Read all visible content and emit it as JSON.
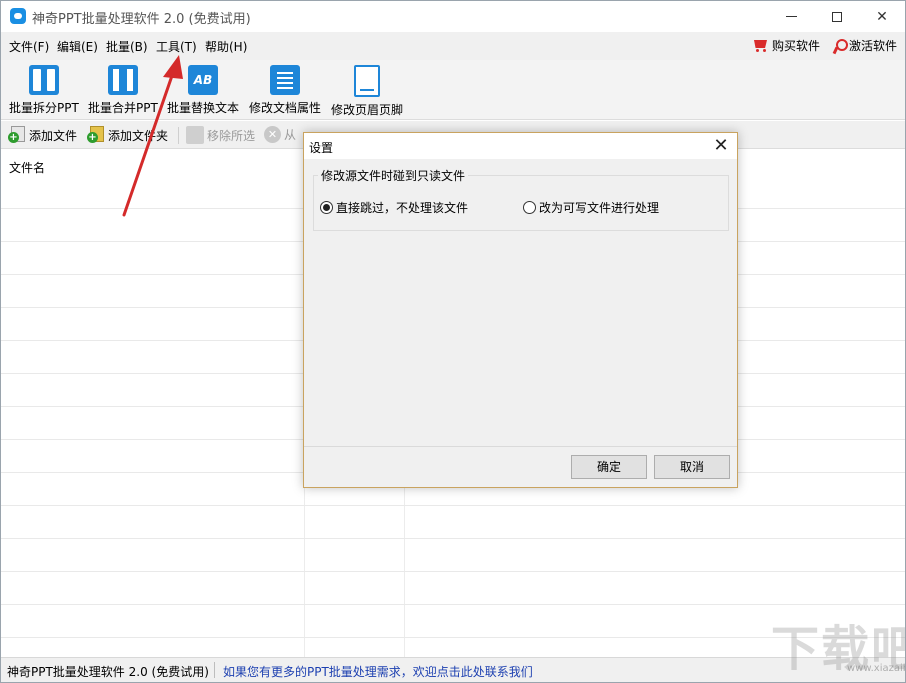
{
  "window": {
    "title": "神奇PPT批量处理软件 2.0 (免费试用)"
  },
  "menu": {
    "items": [
      {
        "name": "menu-file",
        "label": "文件(F)"
      },
      {
        "name": "menu-edit",
        "label": "编辑(E)"
      },
      {
        "name": "menu-batch",
        "label": "批量(B)"
      },
      {
        "name": "menu-tools",
        "label": "工具(T)"
      },
      {
        "name": "menu-help",
        "label": "帮助(H)"
      }
    ],
    "buy_label": "购买软件",
    "activate_label": "激活软件"
  },
  "toolbar": {
    "split": "批量拆分PPT",
    "merge": "批量合并PPT",
    "replace": "批量替换文本",
    "replace_icon_text": "AB",
    "props": "修改文档属性",
    "header_footer": "修改页眉页脚"
  },
  "subtoolbar": {
    "add_file": "添加文件",
    "add_folder": "添加文件夹",
    "remove_selected": "移除所选",
    "remove_from": "从"
  },
  "table": {
    "column_filename": "文件名"
  },
  "dialog": {
    "title": "设置",
    "group_label": "修改源文件时碰到只读文件",
    "option_skip": "直接跳过，不处理该文件",
    "option_writable": "改为可写文件进行处理",
    "selected_option": "skip",
    "ok_label": "确定",
    "cancel_label": "取消"
  },
  "status": {
    "left": "神奇PPT批量处理软件 2.0 (免费试用)",
    "link": "如果您有更多的PPT批量处理需求，欢迎点击此处联系我们"
  },
  "watermark": {
    "text": "下载吧",
    "url": "www.xiazaiba.com"
  },
  "colors": {
    "accent": "#1e86d8",
    "arrow": "#d42a2a",
    "link": "#1c3fb0"
  }
}
